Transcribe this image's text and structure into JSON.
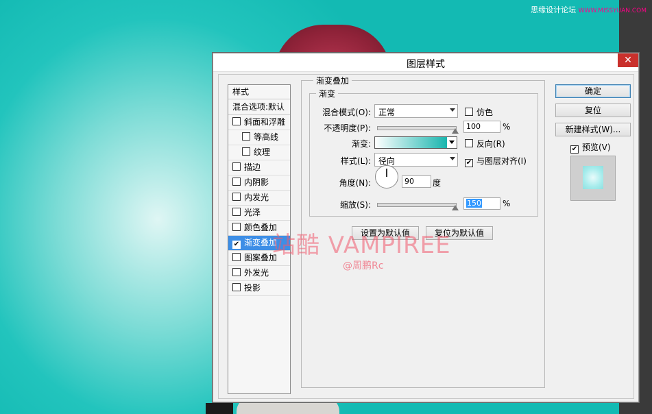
{
  "site_watermark": {
    "text": "思缘设计论坛",
    "url_text": "WWW.MISSYUAN.COM"
  },
  "dialog": {
    "title": "图层样式",
    "close_label": "✕"
  },
  "style_list": {
    "header": "样式",
    "blend_options": "混合选项:默认",
    "items": [
      {
        "label": "斜面和浮雕",
        "checked": false,
        "sub": false
      },
      {
        "label": "等高线",
        "checked": false,
        "sub": true
      },
      {
        "label": "纹理",
        "checked": false,
        "sub": true
      },
      {
        "label": "描边",
        "checked": false,
        "sub": false
      },
      {
        "label": "内阴影",
        "checked": false,
        "sub": false
      },
      {
        "label": "内发光",
        "checked": false,
        "sub": false
      },
      {
        "label": "光泽",
        "checked": false,
        "sub": false
      },
      {
        "label": "颜色叠加",
        "checked": false,
        "sub": false
      },
      {
        "label": "渐变叠加",
        "checked": true,
        "sub": false,
        "selected": true
      },
      {
        "label": "图案叠加",
        "checked": false,
        "sub": false
      },
      {
        "label": "外发光",
        "checked": false,
        "sub": false
      },
      {
        "label": "投影",
        "checked": false,
        "sub": false
      }
    ]
  },
  "gradient_overlay": {
    "section_title": "渐变叠加",
    "group_title": "渐变",
    "blend_mode_label": "混合模式(O):",
    "blend_mode_value": "正常",
    "dither_label": "仿色",
    "dither_checked": false,
    "opacity_label": "不透明度(P):",
    "opacity_value": "100",
    "opacity_fraction": 1.0,
    "percent": "%",
    "gradient_label": "渐变:",
    "gradient_colors": [
      "#ffffff",
      "#19b5ae"
    ],
    "reverse_label": "反向(R)",
    "reverse_checked": false,
    "style_label": "样式(L):",
    "style_value": "径向",
    "align_label": "与图层对齐(I)",
    "align_checked": true,
    "angle_label": "角度(N):",
    "angle_value": "90",
    "angle_unit": "度",
    "scale_label": "缩放(S):",
    "scale_value": "150",
    "scale_fraction": 1.0,
    "set_default_button": "设置为默认值",
    "reset_default_button": "复位为默认值"
  },
  "right_panel": {
    "ok_button": "确定",
    "reset_button": "复位",
    "new_style_button": "新建样式(W)...",
    "preview_label": "预览(V)",
    "preview_checked": true
  },
  "overlay_watermark": {
    "main": "站酷 VAMPIREE",
    "sub": "@周鹏Rc"
  }
}
